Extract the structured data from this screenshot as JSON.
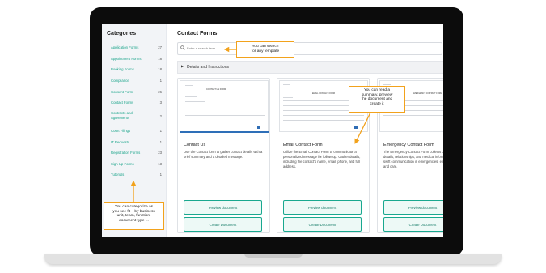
{
  "sidebar": {
    "title": "Categories",
    "items": [
      {
        "label": "Application Forms",
        "count": "27"
      },
      {
        "label": "Appointment Forms",
        "count": "18"
      },
      {
        "label": "Booking Forms",
        "count": "18"
      },
      {
        "label": "Compliance",
        "count": "1"
      },
      {
        "label": "Consent Form",
        "count": "26"
      },
      {
        "label": "Contact Forms",
        "count": "3"
      },
      {
        "label": "Contracts and Agreements",
        "count": "2"
      },
      {
        "label": "Court Filings",
        "count": "1"
      },
      {
        "label": "IT Requests",
        "count": "1"
      },
      {
        "label": "Registration Forms",
        "count": "23"
      },
      {
        "label": "Sign Up Forms",
        "count": "13"
      },
      {
        "label": "Tutorials",
        "count": "1"
      }
    ]
  },
  "main": {
    "title": "Contact Forms",
    "search_placeholder": "Enter a search term...",
    "details_label": "Details and Instructions",
    "cards": [
      {
        "thumb_title": "CONTACT US FORM",
        "title": "Contact Us",
        "description": "Use the Contact form to gather contact details with a brief summary and a detailed message.",
        "preview_label": "Preview document",
        "create_label": "Create Document"
      },
      {
        "thumb_title": "EMAIL CONTACT FORM",
        "title": "Email Contact Form",
        "description": "Utilize the Email Contact Form to communicate a personalized message for follow-up. Gather details, including the contact's name, email, phone, and full address.",
        "preview_label": "Preview document",
        "create_label": "Create Document"
      },
      {
        "thumb_title": "EMERGENCY CONTACT FORM",
        "title": "Emergency Contact Form",
        "description": "The Emergency Contact Form collects contact details, relationships, and medical information for swift communication in emergencies, ensuring safety and care.",
        "preview_label": "Preview document",
        "create_label": "Create Document"
      }
    ]
  },
  "callouts": {
    "search": [
      "You can search",
      "for any template"
    ],
    "preview": [
      "You can read a",
      "summary, preview",
      "the document and",
      "create it"
    ],
    "categorize": [
      "You can categorize as",
      "you see fit – by business",
      "unit, team, function,",
      "document type ..."
    ]
  },
  "colors": {
    "accent": "#19a88f",
    "callout_border": "#f2a21c",
    "sidebar_bg": "#f2f4f7"
  }
}
